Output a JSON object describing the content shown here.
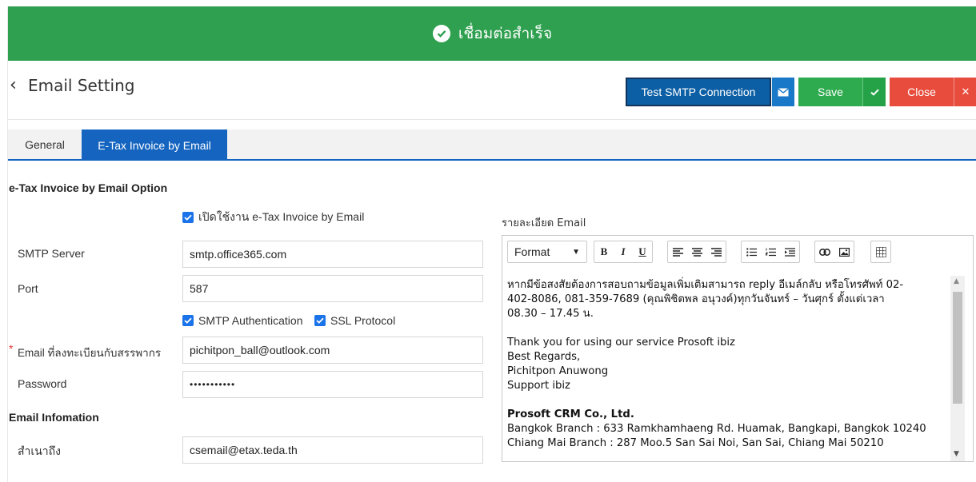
{
  "banner": {
    "message": "เชื่อมต่อสำเร็จ",
    "icon": "check-circle-icon",
    "color": "#2ea04f"
  },
  "header": {
    "title": "Email Setting",
    "back_icon": "chevron-left-icon",
    "buttons": {
      "test_label": "Test SMTP Connection",
      "test_icon": "envelope-icon",
      "save_label": "Save",
      "save_icon": "check-icon",
      "close_label": "Close",
      "close_icon": "close-icon"
    }
  },
  "tabs": [
    {
      "label": "General",
      "active": false
    },
    {
      "label": "E-Tax Invoice by Email",
      "active": true
    }
  ],
  "option_section": {
    "title": "e-Tax Invoice by Email Option",
    "enable_label": "เปิดใช้งาน e-Tax Invoice by Email",
    "enable_checked": true
  },
  "form": {
    "smtp_server": {
      "label": "SMTP Server",
      "value": "smtp.office365.com"
    },
    "port": {
      "label": "Port",
      "value": "587"
    },
    "smtp_auth": {
      "label": "SMTP Authentication",
      "checked": true
    },
    "ssl": {
      "label": "SSL Protocol",
      "checked": true
    },
    "email": {
      "required_mark": "*",
      "label": "Email ที่ลงทะเบียนกับสรรพากร",
      "value": "pichitpon_ball@outlook.com"
    },
    "password": {
      "label": "Password",
      "value": "•••••••••••"
    }
  },
  "info_section": {
    "title": "Email Infomation",
    "cc": {
      "label": "สำเนาถึง",
      "value": "csemail@etax.teda.th"
    }
  },
  "editor": {
    "label": "รายละเอียด Email",
    "format_label": "Format",
    "body": {
      "line1": "หากมีข้อสงสัยต้องการสอบถามข้อมูลเพิ่มเติมสามารถ reply อีเมล์กลับ หรือโทรศัพท์ 02-",
      "line2": "402-8086, 081-359-7689 (คุณพิชิตพล อนุวงค์)ทุกวันจันทร์ – วันศุกร์ ตั้งแต่เวลา",
      "line3": "08.30 – 17.45 น.",
      "thanks": "Thank you for using our service Prosoft ibiz",
      "regards": "Best Regards,",
      "name": "Pichitpon Anuwong",
      "team": "Support ibiz",
      "company": "Prosoft CRM Co., Ltd.",
      "branch1": "Bangkok Branch : 633 Ramkhamhaeng Rd. Huamak, Bangkapi, Bangkok 10240",
      "branch2": "Chiang Mai Branch : 287 Moo.5 San Sai Noi, San Sai, Chiang Mai 50210"
    }
  }
}
